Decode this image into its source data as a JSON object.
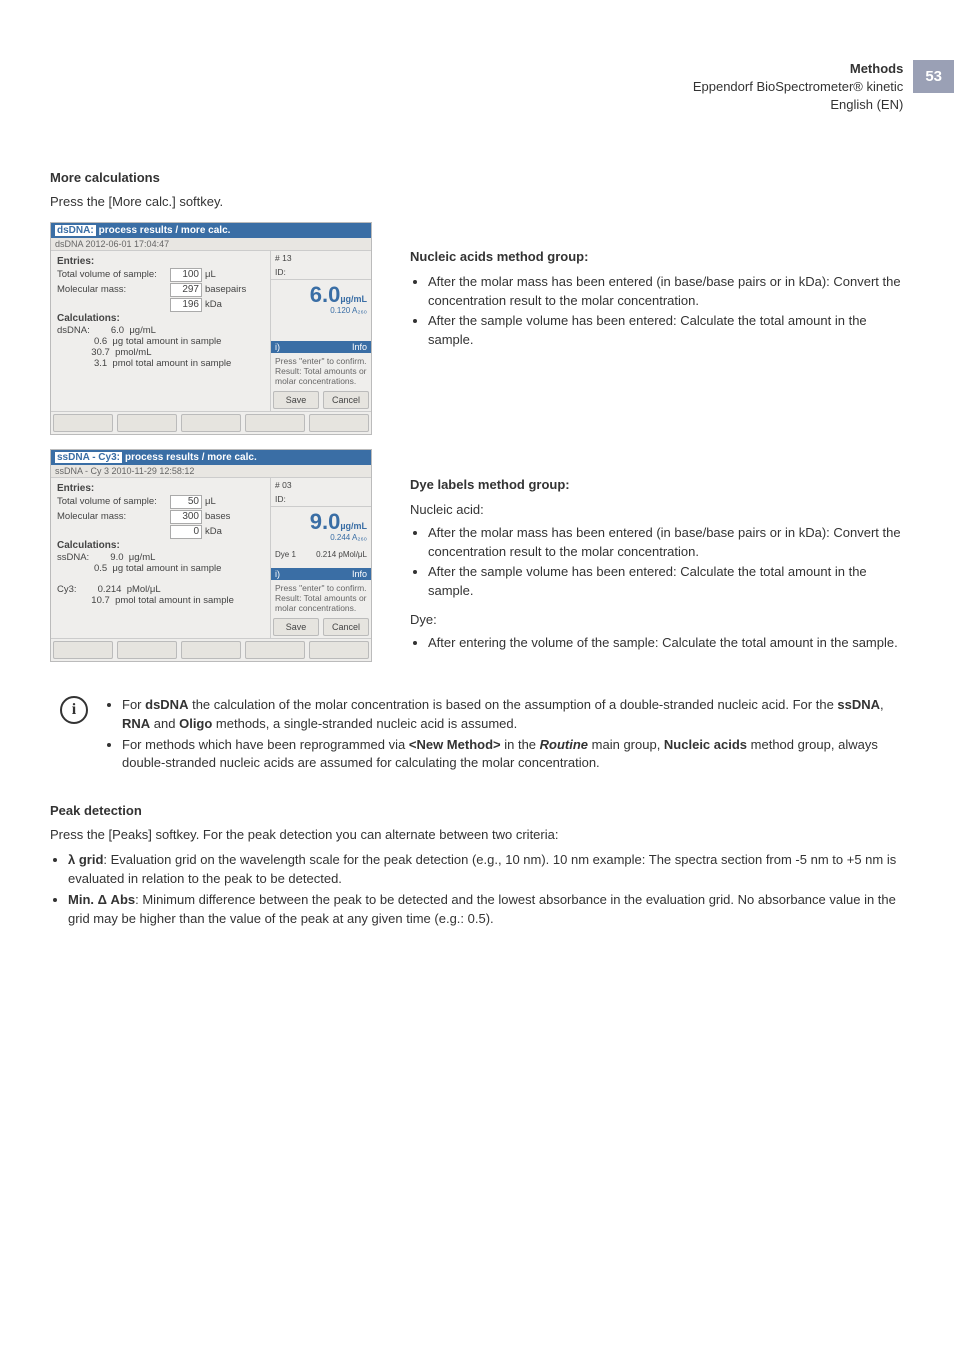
{
  "header": {
    "line1": "Methods",
    "line2": "Eppendorf BioSpectrometer® kinetic",
    "line3": "English (EN)",
    "page": "53"
  },
  "section1": {
    "title": "More calculations",
    "intro": "Press the [More calc.] softkey."
  },
  "shot1": {
    "title_prefix": "dsDNA:",
    "title_rest": "process results / more calc.",
    "sub": "dsDNA 2012-06-01 17:04:47",
    "entries_label": "Entries:",
    "tv_label": "Total volume of sample:",
    "tv_val": "100",
    "tv_unit": "μL",
    "mm_label": "Molecular mass:",
    "mm_val": "297",
    "mm_unit": "basepairs",
    "mm2_val": "196",
    "mm2_unit": "kDa",
    "calc_label": "Calculations:",
    "lines": [
      "dsDNA:        6.0  μg/mL",
      "              0.6  μg total amount in sample",
      "             30.7  pmol/mL",
      "              3.1  pmol total amount in sample"
    ],
    "side_hash": "# 13",
    "side_id": "ID:",
    "big": "6.0",
    "big_unit": "µg/mL",
    "big_sub": "0.120 A₂₆₀",
    "info_head_l": "i)",
    "info_head_r": "Info",
    "info_body": "Press \"enter\" to confirm. Result: Total amounts or molar concentrations.",
    "save": "Save",
    "cancel": "Cancel"
  },
  "right1": {
    "head": "Nucleic acids method group:",
    "b1": "After the molar mass has been entered (in base/base pairs or in kDa): Convert the concentration result to the molar concentration.",
    "b2": "After the sample volume has been entered: Calculate the total amount in the sample."
  },
  "shot2": {
    "title_prefix": "ssDNA - Cy3:",
    "title_rest": "process results / more calc.",
    "sub": "ssDNA - Cy 3 2010-11-29 12:58:12",
    "entries_label": "Entries:",
    "tv_label": "Total volume of sample:",
    "tv_val": "50",
    "tv_unit": "μL",
    "mm_label": "Molecular mass:",
    "mm_val": "300",
    "mm_unit": "bases",
    "mm2_val": "0",
    "mm2_unit": "kDa",
    "calc_label": "Calculations:",
    "lines": [
      "ssDNA:        9.0  μg/mL",
      "              0.5  μg total amount in sample",
      "",
      "Cy3:        0.214  pMol/μL",
      "             10.7  pmol total amount in sample"
    ],
    "side_hash": "# 03",
    "side_id": "ID:",
    "big": "9.0",
    "big_unit": "µg/mL",
    "big_sub": "0.244 A₂₆₀",
    "dye_label": "Dye 1",
    "dye_val": "0.214 pMol/μL",
    "info_head_l": "i)",
    "info_head_r": "Info",
    "info_body": "Press \"enter\" to confirm. Result: Total amounts or molar concentrations.",
    "save": "Save",
    "cancel": "Cancel"
  },
  "right2": {
    "head": "Dye labels method group:",
    "na_label": "Nucleic acid:",
    "na_b1": "After the molar mass has been entered (in base/base pairs or in kDa): Convert the concentration result to the molar concentration.",
    "na_b2": "After the sample volume has been entered: Calculate the total amount in the sample.",
    "dye_label": "Dye:",
    "dye_b1": "After entering the volume of the sample: Calculate the total amount in the sample."
  },
  "note": {
    "b1_pre": "For ",
    "b1_ds": "dsDNA",
    "b1_mid": " the calculation of the molar concentration is based on the assumption of a double-stranded nucleic acid. For the ",
    "b1_ss": "ssDNA",
    "b1_c": ", ",
    "b1_rna": "RNA",
    "b1_and": " and ",
    "b1_oligo": "Oligo",
    "b1_end": " methods, a single-stranded nucleic acid is assumed.",
    "b2_pre": "For methods which have been reprogrammed via ",
    "b2_new": "<New Method>",
    "b2_mid": " in the ",
    "b2_routine": "Routine",
    "b2_mid2": " main group, ",
    "b2_na": "Nucleic acids",
    "b2_end": " method group, always double-stranded nucleic acids are assumed for calculating the molar concentration."
  },
  "peak": {
    "title": "Peak detection",
    "intro": "Press the [Peaks] softkey. For the peak detection you can alternate between two criteria:",
    "b1_label": "λ grid",
    "b1_text": ": Evaluation grid on the wavelength scale for the peak detection (e.g., 10 nm). 10 nm example: The spectra section from -5 nm to +5 nm is evaluated in relation to the peak to be detected.",
    "b2_label": "Min. Δ Abs",
    "b2_text": ": Minimum difference between the peak to be detected and the lowest absorbance in the evaluation grid. No absorbance value in the grid may be higher than the value of the peak at any given time (e.g.: 0.5)."
  }
}
